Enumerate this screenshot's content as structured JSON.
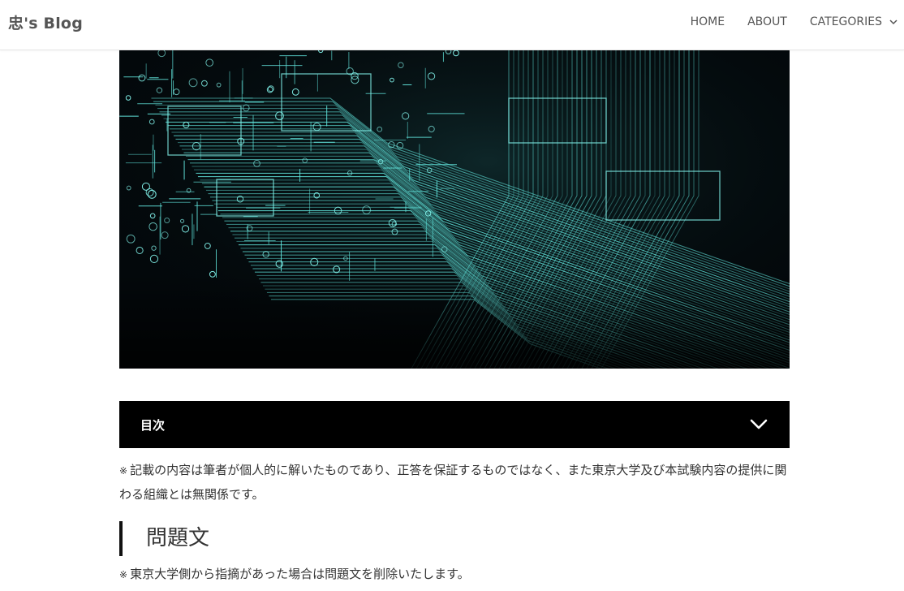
{
  "site": {
    "brand": "忠's Blog"
  },
  "nav": {
    "items": [
      {
        "label": "HOME"
      },
      {
        "label": "ABOUT"
      },
      {
        "label": "CATEGORIES"
      }
    ]
  },
  "toc": {
    "title": "目次"
  },
  "article": {
    "disclaimer_mark": "※",
    "disclaimer": "記載の内容は筆者が個人的に解いたものであり、正答を保証するものではなく、また東京大学及び本試験内容の提供に関わる組織とは無関係です。",
    "section_heading": "問題文",
    "removal_mark": "※",
    "removal_note": "東京大学側から指摘があった場合は問題文を削除いたします。"
  },
  "colors": {
    "toc_background": "#000000",
    "circuit_trace": "#5fe0d8",
    "hero_background": "#03080b"
  },
  "icons": {
    "categories_dropdown": "chevron-down-icon",
    "toc_toggle": "chevron-down-icon"
  }
}
